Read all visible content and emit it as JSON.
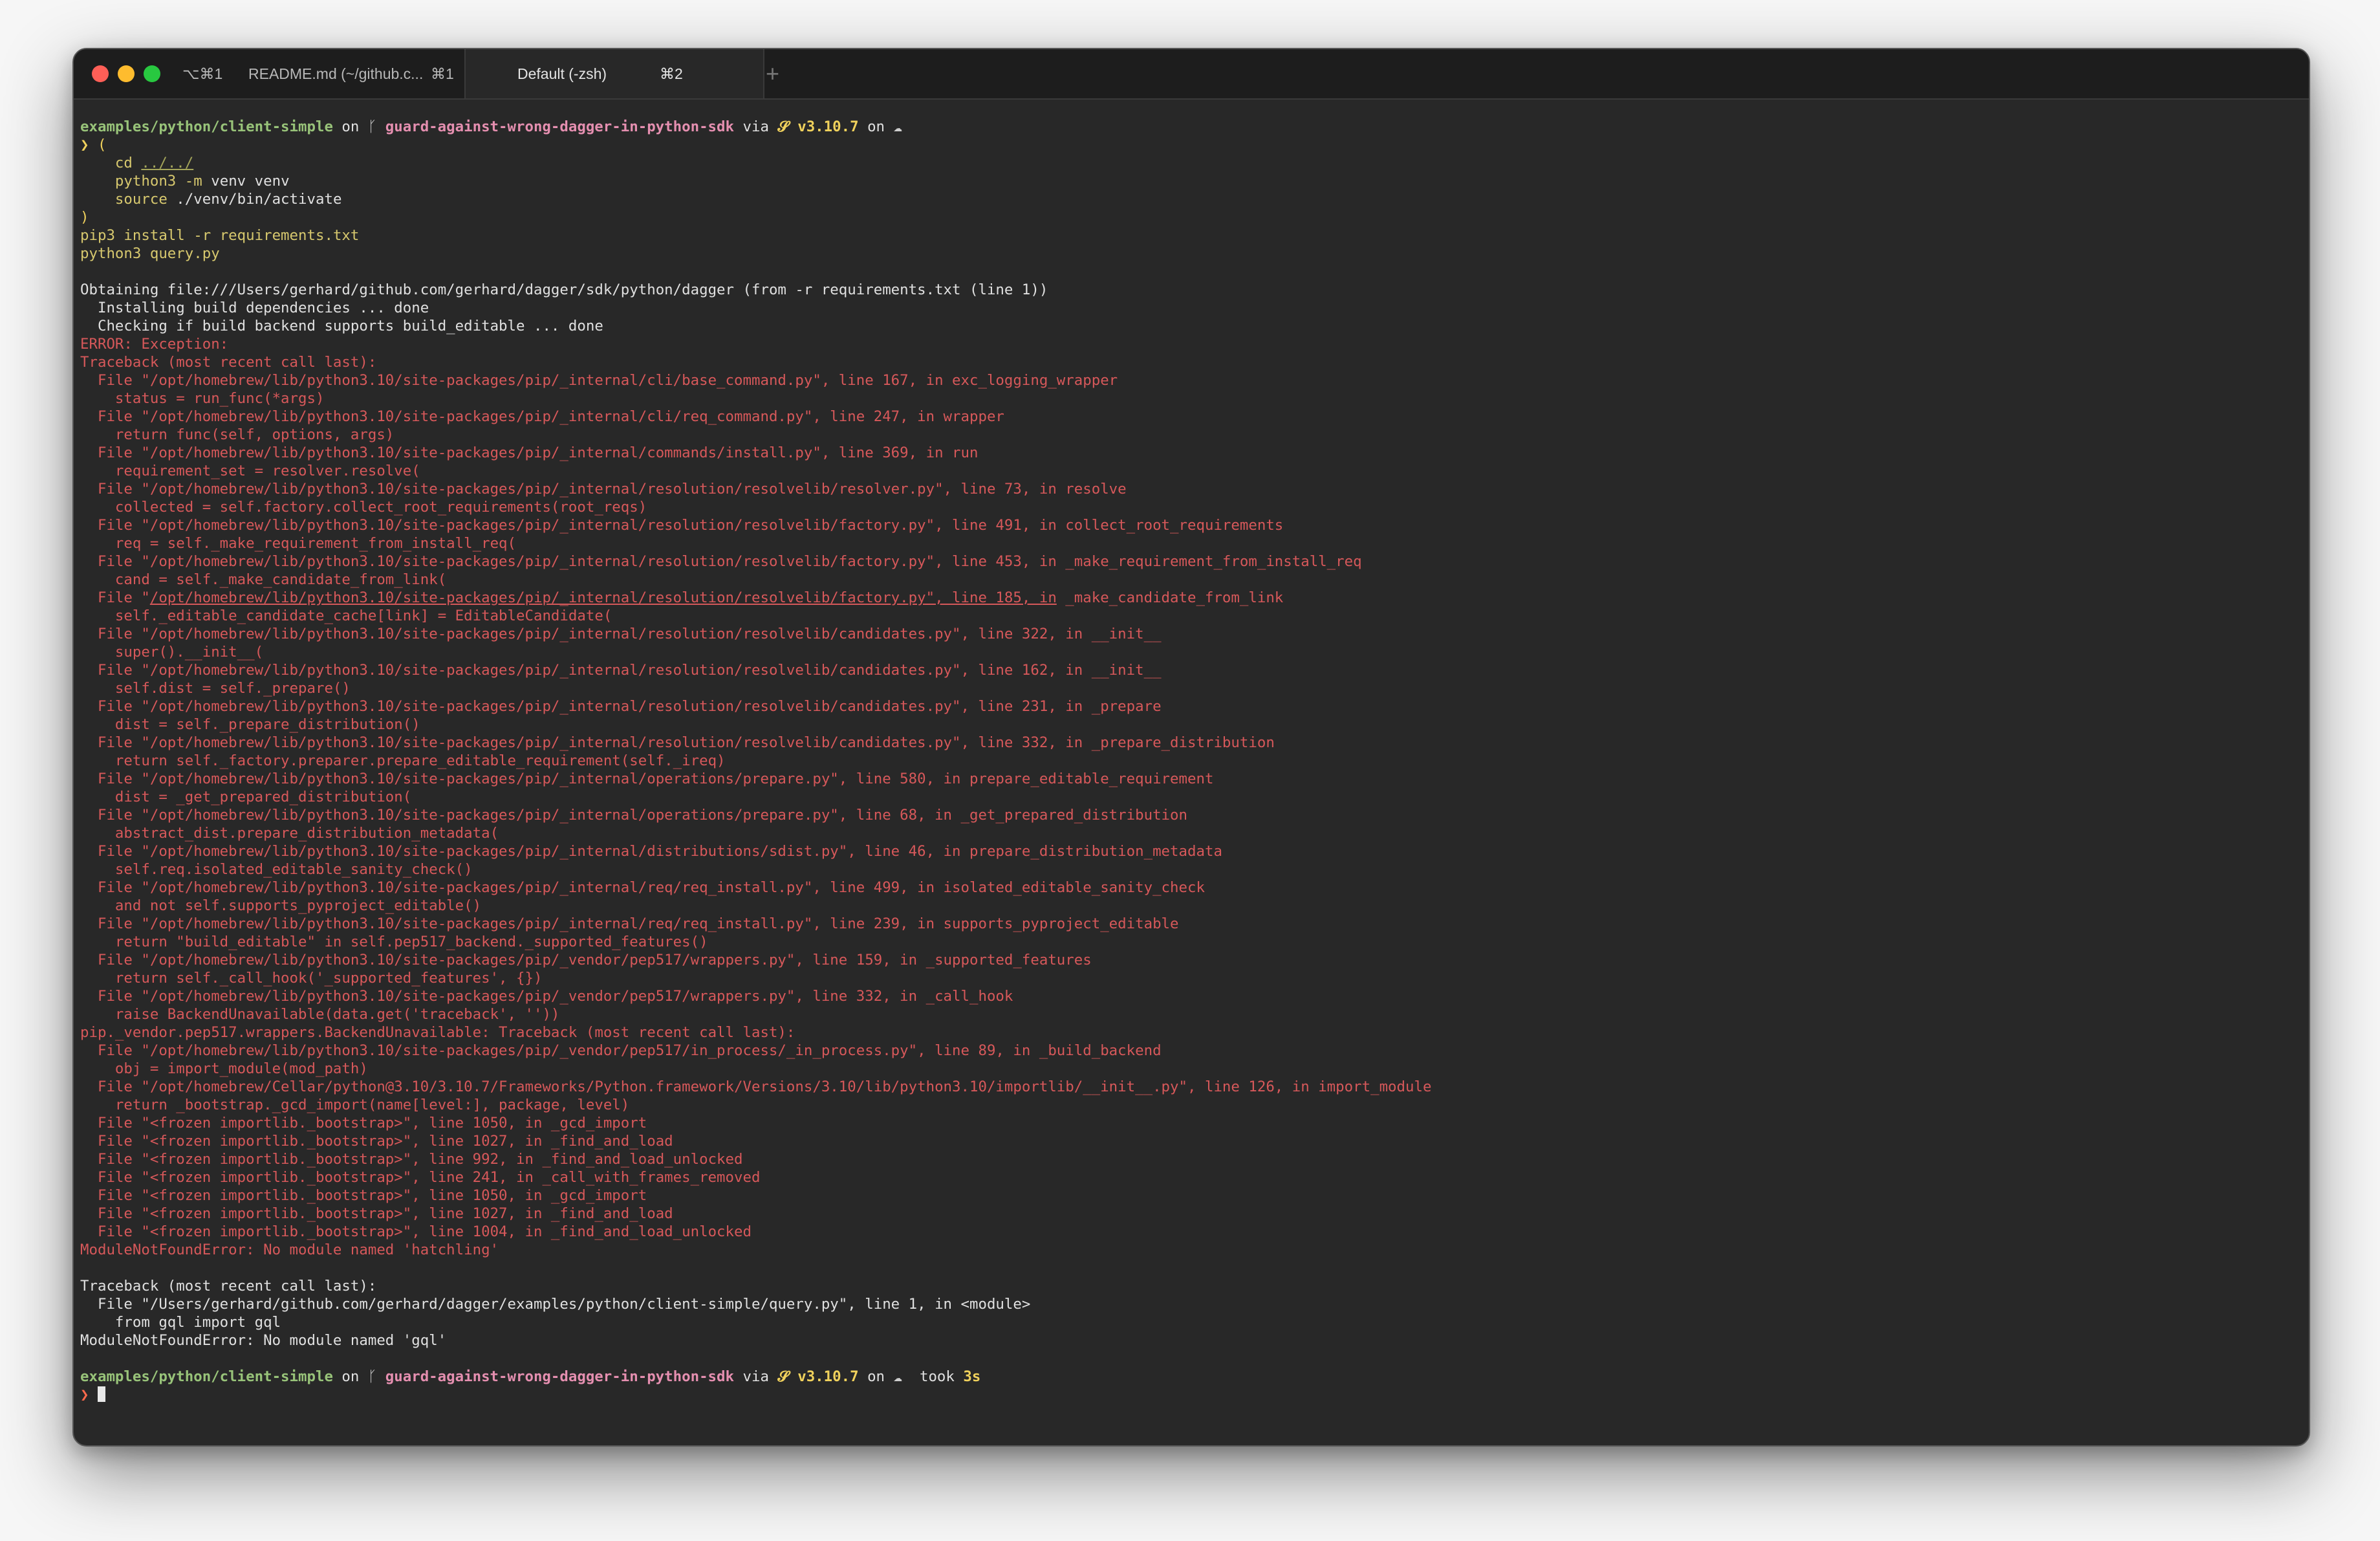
{
  "window": {
    "tab1_shortcut_prefix": "⌥⌘1",
    "tab1_title": "README.md (~/github.c...",
    "tab1_shortcut": "⌘1",
    "tab2_title": "Default (-zsh)",
    "tab2_shortcut": "⌘2",
    "new_tab": "+"
  },
  "prompt1": {
    "dir": "examples/python/client-simple",
    "on": " on ",
    "branch": "guard-against-wrong-dagger-in-python-sdk",
    "via": " via ",
    "py_version": "v3.10.7",
    "on2": " on "
  },
  "command": {
    "l1": "❯ (",
    "l2_cd": "cd",
    "l2_arg": "../../",
    "l3_py": "python3",
    "l3_flag": "-m",
    "l3_rest": " venv venv",
    "l4_src": "source",
    "l4_rest": " ./venv/bin/activate",
    "l5": ")",
    "l6_pip": "pip3 install",
    "l6_flag": "-r",
    "l6_rest": " requirements.txt",
    "l7": "python3 query.py"
  },
  "output_normal": [
    "Obtaining file:///Users/gerhard/github.com/gerhard/dagger/sdk/python/dagger (from -r requirements.txt (line 1))",
    "  Installing build dependencies ... done",
    "  Checking if build backend supports build_editable ... done"
  ],
  "error_lines": [
    "ERROR: Exception:",
    "Traceback (most recent call last):",
    "  File \"/opt/homebrew/lib/python3.10/site-packages/pip/_internal/cli/base_command.py\", line 167, in exc_logging_wrapper",
    "    status = run_func(*args)",
    "  File \"/opt/homebrew/lib/python3.10/site-packages/pip/_internal/cli/req_command.py\", line 247, in wrapper",
    "    return func(self, options, args)",
    "  File \"/opt/homebrew/lib/python3.10/site-packages/pip/_internal/commands/install.py\", line 369, in run",
    "    requirement_set = resolver.resolve(",
    "  File \"/opt/homebrew/lib/python3.10/site-packages/pip/_internal/resolution/resolvelib/resolver.py\", line 73, in resolve",
    "    collected = self.factory.collect_root_requirements(root_reqs)",
    "  File \"/opt/homebrew/lib/python3.10/site-packages/pip/_internal/resolution/resolvelib/factory.py\", line 491, in collect_root_requirements",
    "    req = self._make_requirement_from_install_req(",
    "  File \"/opt/homebrew/lib/python3.10/site-packages/pip/_internal/resolution/resolvelib/factory.py\", line 453, in _make_requirement_from_install_req",
    "    cand = self._make_candidate_from_link("
  ],
  "link_line": {
    "pre": "  File \"",
    "link": "/opt/homebrew/lib/python3.10/site-packages/pip/_internal/resolution/resolvelib/factory.py\", line 185, in",
    "post": " _make_candidate_from_link"
  },
  "error_lines2": [
    "    self._editable_candidate_cache[link] = EditableCandidate(",
    "  File \"/opt/homebrew/lib/python3.10/site-packages/pip/_internal/resolution/resolvelib/candidates.py\", line 322, in __init__",
    "    super().__init__(",
    "  File \"/opt/homebrew/lib/python3.10/site-packages/pip/_internal/resolution/resolvelib/candidates.py\", line 162, in __init__",
    "    self.dist = self._prepare()",
    "  File \"/opt/homebrew/lib/python3.10/site-packages/pip/_internal/resolution/resolvelib/candidates.py\", line 231, in _prepare",
    "    dist = self._prepare_distribution()",
    "  File \"/opt/homebrew/lib/python3.10/site-packages/pip/_internal/resolution/resolvelib/candidates.py\", line 332, in _prepare_distribution",
    "    return self._factory.preparer.prepare_editable_requirement(self._ireq)",
    "  File \"/opt/homebrew/lib/python3.10/site-packages/pip/_internal/operations/prepare.py\", line 580, in prepare_editable_requirement",
    "    dist = _get_prepared_distribution(",
    "  File \"/opt/homebrew/lib/python3.10/site-packages/pip/_internal/operations/prepare.py\", line 68, in _get_prepared_distribution",
    "    abstract_dist.prepare_distribution_metadata(",
    "  File \"/opt/homebrew/lib/python3.10/site-packages/pip/_internal/distributions/sdist.py\", line 46, in prepare_distribution_metadata",
    "    self.req.isolated_editable_sanity_check()",
    "  File \"/opt/homebrew/lib/python3.10/site-packages/pip/_internal/req/req_install.py\", line 499, in isolated_editable_sanity_check",
    "    and not self.supports_pyproject_editable()",
    "  File \"/opt/homebrew/lib/python3.10/site-packages/pip/_internal/req/req_install.py\", line 239, in supports_pyproject_editable",
    "    return \"build_editable\" in self.pep517_backend._supported_features()",
    "  File \"/opt/homebrew/lib/python3.10/site-packages/pip/_vendor/pep517/wrappers.py\", line 159, in _supported_features",
    "    return self._call_hook('_supported_features', {})",
    "  File \"/opt/homebrew/lib/python3.10/site-packages/pip/_vendor/pep517/wrappers.py\", line 332, in _call_hook",
    "    raise BackendUnavailable(data.get('traceback', ''))",
    "pip._vendor.pep517.wrappers.BackendUnavailable: Traceback (most recent call last):",
    "  File \"/opt/homebrew/lib/python3.10/site-packages/pip/_vendor/pep517/in_process/_in_process.py\", line 89, in _build_backend",
    "    obj = import_module(mod_path)",
    "  File \"/opt/homebrew/Cellar/python@3.10/3.10.7/Frameworks/Python.framework/Versions/3.10/lib/python3.10/importlib/__init__.py\", line 126, in import_module",
    "    return _bootstrap._gcd_import(name[level:], package, level)",
    "  File \"<frozen importlib._bootstrap>\", line 1050, in _gcd_import",
    "  File \"<frozen importlib._bootstrap>\", line 1027, in _find_and_load",
    "  File \"<frozen importlib._bootstrap>\", line 992, in _find_and_load_unlocked",
    "  File \"<frozen importlib._bootstrap>\", line 241, in _call_with_frames_removed",
    "  File \"<frozen importlib._bootstrap>\", line 1050, in _gcd_import",
    "  File \"<frozen importlib._bootstrap>\", line 1027, in _find_and_load",
    "  File \"<frozen importlib._bootstrap>\", line 1004, in _find_and_load_unlocked",
    "ModuleNotFoundError: No module named 'hatchling'"
  ],
  "output_tail": [
    "Traceback (most recent call last):",
    "  File \"/Users/gerhard/github.com/gerhard/dagger/examples/python/client-simple/query.py\", line 1, in <module>",
    "    from gql import gql",
    "ModuleNotFoundError: No module named 'gql'"
  ],
  "prompt2": {
    "dir": "examples/python/client-simple",
    "on": " on ",
    "branch": "guard-against-wrong-dagger-in-python-sdk",
    "via": " via ",
    "py_version": "v3.10.7",
    "on2": " on ",
    "took": "took ",
    "duration": "3s"
  },
  "final_prompt": "❯ ",
  "icons": {
    "branch": "branch-icon",
    "python": "python-snake-icon",
    "cloud": "cloud-icon"
  },
  "colors": {
    "error": "#d6585a",
    "path": "#98c379",
    "branch": "#e58fb0",
    "version": "#f0d15c"
  }
}
